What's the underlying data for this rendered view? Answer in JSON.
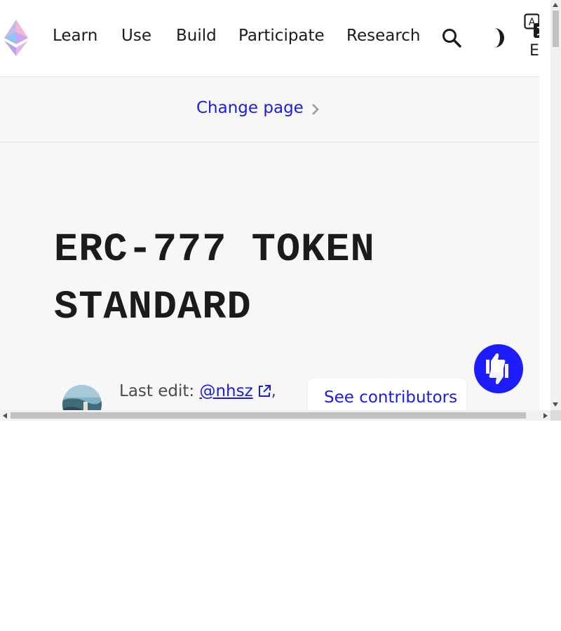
{
  "nav": {
    "items": [
      "Learn",
      "Use",
      "Build",
      "Participate",
      "Research"
    ],
    "language": "EN"
  },
  "change_page": {
    "label": "Change page"
  },
  "page": {
    "title_line1": "ERC-777 TOKEN",
    "title_line2": "STANDARD"
  },
  "contributors": {
    "last_edit_label": "Last edit:",
    "last_edit_user": "@nhsz",
    "separator": ",",
    "see_contributors": "See contributors"
  },
  "colors": {
    "accent": "#1c1ce1",
    "feedback_bg": "#1c1cff",
    "page_bg": "#f7f7f7",
    "text": "#1b1b1b"
  }
}
